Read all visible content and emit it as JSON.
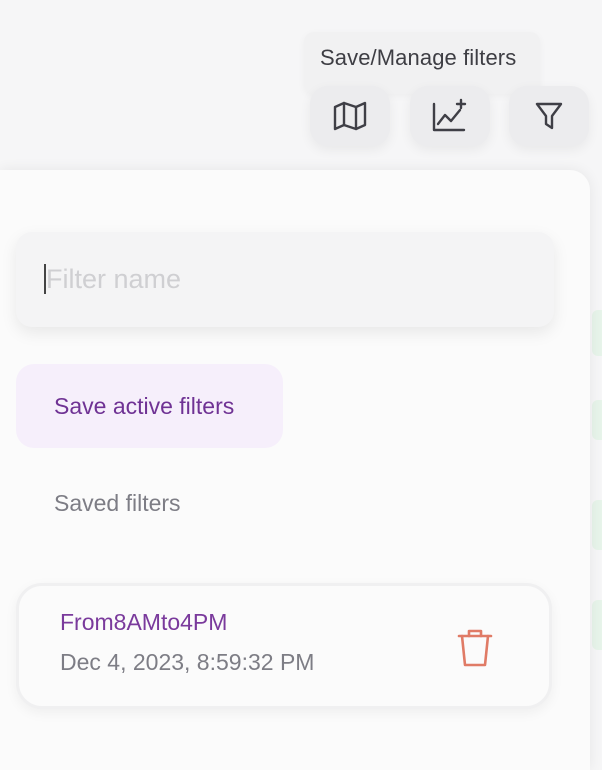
{
  "tooltip": {
    "text": "Save/Manage filters"
  },
  "toolbar": {
    "buttons": [
      {
        "name": "map",
        "icon": "map-icon"
      },
      {
        "name": "add-chart",
        "icon": "chart-add-icon"
      },
      {
        "name": "filter",
        "icon": "filter-icon"
      }
    ]
  },
  "filter_form": {
    "input_value": "",
    "input_placeholder": "Filter name",
    "save_label": "Save active filters"
  },
  "saved_filters": {
    "heading": "Saved filters",
    "items": [
      {
        "name": "From8AMto4PM",
        "date": "Dec 4, 2023, 8:59:32 PM",
        "delete_icon": "trash-icon"
      }
    ]
  },
  "colors": {
    "accent": "#6f3294",
    "delete": "#e07b66",
    "save_bg": "#f6effb"
  }
}
